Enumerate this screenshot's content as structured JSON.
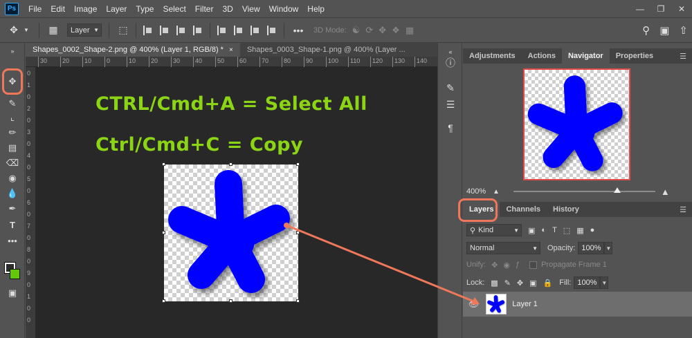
{
  "menubar": {
    "logo": "Ps",
    "items": [
      "File",
      "Edit",
      "Image",
      "Layer",
      "Type",
      "Select",
      "Filter",
      "3D",
      "View",
      "Window",
      "Help"
    ]
  },
  "options": {
    "layer_select": "Layer",
    "mode_3d": "3D Mode:"
  },
  "tabs": [
    {
      "label": "Shapes_0002_Shape-2.png @ 400% (Layer 1, RGB/8) *",
      "close": "×"
    },
    {
      "label": "Shapes_0003_Shape-1.png @ 400% (Layer ...",
      "close": ""
    }
  ],
  "ruler_top": [
    "30",
    "20",
    "10",
    "0",
    "10",
    "20",
    "30",
    "40",
    "50",
    "60",
    "70",
    "80",
    "90",
    "100",
    "110",
    "120",
    "130",
    "140"
  ],
  "ruler_left": [
    "0",
    "1",
    "0",
    "2",
    "0",
    "3",
    "0",
    "4",
    "0",
    "5",
    "0",
    "6",
    "0",
    "7",
    "0",
    "8",
    "0",
    "9",
    "0",
    "1",
    "0",
    "0"
  ],
  "canvas": {
    "line1": "CTRL/Cmd+A = Select All",
    "line2": "Ctrl/Cmd+C = Copy",
    "shape_color": "#0000ff",
    "text_color": "#8cd514",
    "annotation_color": "#f0785a"
  },
  "top_panel": {
    "tabs": [
      "Adjustments",
      "Actions",
      "Navigator",
      "Properties"
    ],
    "active": "Navigator",
    "zoom": "400%"
  },
  "layers_panel": {
    "tabs": [
      "Layers",
      "Channels",
      "History"
    ],
    "active": "Layers",
    "kind_label": "Kind",
    "blend_mode": "Normal",
    "opacity_label": "Opacity:",
    "opacity_value": "100%",
    "unify_label": "Unify:",
    "propagate_label": "Propagate Frame 1",
    "lock_label": "Lock:",
    "fill_label": "Fill:",
    "fill_value": "100%",
    "layers": [
      {
        "name": "Layer 1",
        "visible": true
      }
    ]
  },
  "colors": {
    "foreground": "#2b2b2b",
    "background": "#64c80a"
  }
}
